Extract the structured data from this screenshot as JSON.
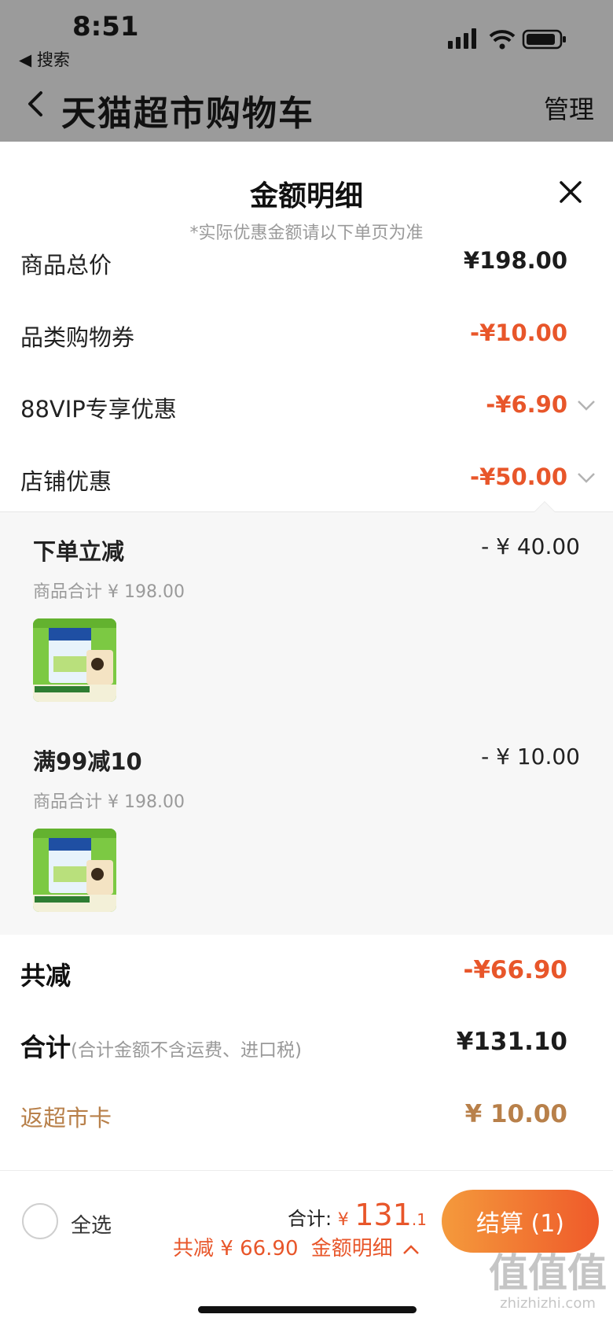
{
  "status_bar": {
    "time": "8:51",
    "back_app": "◀ 搜索"
  },
  "nav": {
    "title": "天猫超市购物车",
    "manage": "管理"
  },
  "sheet": {
    "title": "金额明细",
    "note": "*实际优惠金额请以下单页为准",
    "rows": [
      {
        "label": "商品总价",
        "value": "¥198.00"
      },
      {
        "label": "品类购物券",
        "value": "-¥10.00"
      },
      {
        "label": "88VIP专享优惠",
        "value": "-¥6.90"
      },
      {
        "label": "店铺优惠",
        "value": "-¥50.00"
      }
    ],
    "promos": [
      {
        "title": "下单立减",
        "amount": "- ¥ 40.00",
        "subtotal": "商品合计 ¥ 198.00"
      },
      {
        "title": "满99减10",
        "amount": "- ¥ 10.00",
        "subtotal": "商品合计 ¥ 198.00"
      }
    ],
    "total_reduce": {
      "label": "共减",
      "value": "-¥66.90"
    },
    "total": {
      "label": "合计",
      "hint": "(合计金额不含运费、进口税)",
      "value": "¥131.10"
    },
    "rebate": {
      "label": "返超市卡",
      "value": "¥ 10.00"
    }
  },
  "bottom": {
    "select_all": "全选",
    "sum_label": "合计:",
    "sum_currency": "¥",
    "sum_int": "131",
    "sum_dec": ".1",
    "save_text": "共减 ¥ 66.90",
    "detail_link": "金额明细",
    "checkout": "结算 (1)"
  },
  "watermark": {
    "main": "值值值",
    "sub": "zhizhizhi.com"
  },
  "colors": {
    "accent": "#e8562a",
    "gold": "#b8804a",
    "checkout_from": "#f49a3c",
    "checkout_to": "#ef5a2a"
  }
}
